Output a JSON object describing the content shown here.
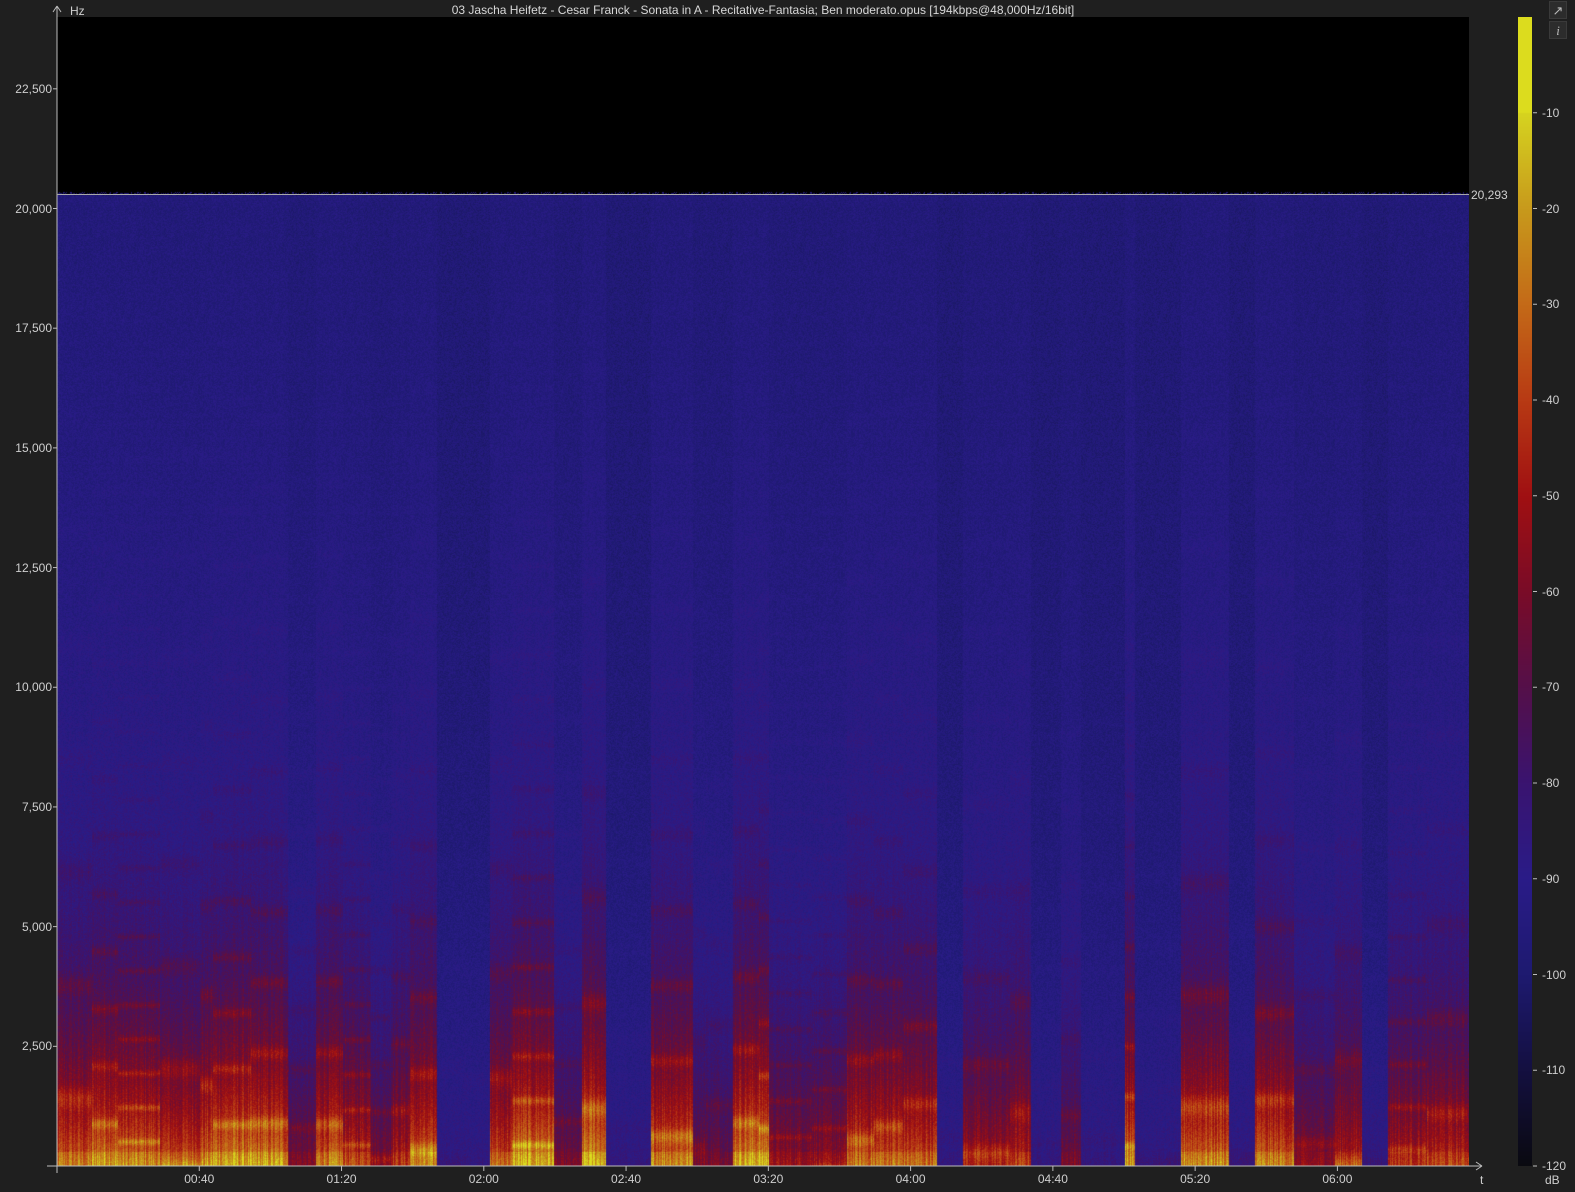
{
  "title": "03 Jascha Heifetz - Cesar Franck - Sonata in A - Recitative-Fantasia; Ben moderato.opus [194kbps@48,000Hz/16bit]",
  "buttons": {
    "popout_icon": "external-link-icon",
    "info_label": "i"
  },
  "chart_data": {
    "type": "heatmap",
    "title": "03 Jascha Heifetz - Cesar Franck - Sonata in A - Recitative-Fantasia; Ben moderato.opus [194kbps@48,000Hz/16bit]",
    "ylabel": "Hz",
    "xlabel": "t",
    "ylim": [
      0,
      24000
    ],
    "xlim_seconds": [
      0,
      397
    ],
    "y_ticks": [
      "22,500",
      "20,000",
      "17,500",
      "15,000",
      "12,500",
      "10,000",
      "7,500",
      "5,000",
      "2,500"
    ],
    "y_tick_values": [
      22500,
      20000,
      17500,
      15000,
      12500,
      10000,
      7500,
      5000,
      2500
    ],
    "x_ticks": [
      "00:40",
      "01:20",
      "02:00",
      "02:40",
      "03:20",
      "04:00",
      "04:40",
      "05:20",
      "06:00"
    ],
    "x_tick_values": [
      40,
      80,
      120,
      160,
      200,
      240,
      280,
      320,
      360
    ],
    "cutoff_label": "20,293",
    "cutoff_hz": 20293,
    "colorbar": {
      "unit": "dB",
      "range": [
        -120,
        0
      ],
      "ticks": [
        "-10",
        "-20",
        "-30",
        "-40",
        "-50",
        "-60",
        "-70",
        "-80",
        "-90",
        "-100",
        "-110",
        "-120"
      ],
      "tick_values": [
        -10,
        -20,
        -30,
        -40,
        -50,
        -60,
        -70,
        -80,
        -90,
        -100,
        -110,
        -120
      ],
      "colors": [
        "#d6d420",
        "#c89a1c",
        "#c46a18",
        "#b83a14",
        "#a01012",
        "#7a0c28",
        "#55104a",
        "#3a1470",
        "#2a1c88",
        "#1e1a70",
        "#141040",
        "#0a0a10"
      ]
    }
  }
}
